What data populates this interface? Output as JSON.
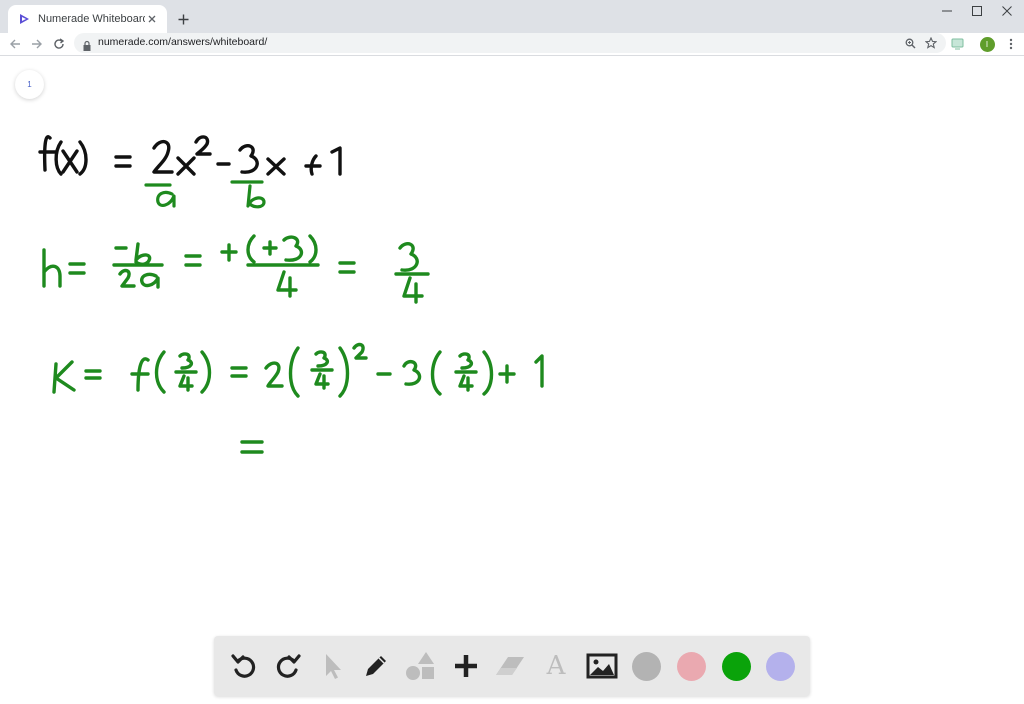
{
  "browser": {
    "tab_title": "Numerade Whiteboard",
    "url": "numerade.com/answers/whiteboard/",
    "profile_initial": "I"
  },
  "whiteboard": {
    "page_number": "1",
    "ink_color": "#1e8a1e",
    "handwriting": {
      "line1": "f(x) = 2x^2 - 3x + 1",
      "line1_labels": [
        "a",
        "b"
      ],
      "line2": "h = -b/2a = +(+3)/4 = 3/4",
      "line3": "K = f(3/4) = 2(3/4)^2 - 3(3/4) + 1",
      "line4": "="
    }
  },
  "toolbar": {
    "tools": [
      "undo-icon",
      "redo-icon",
      "pointer-icon",
      "pen-icon",
      "shapes-icon",
      "plus-icon",
      "eraser-icon",
      "text-icon",
      "image-icon"
    ],
    "text_tool_glyph": "A",
    "colors": [
      "#b3b3b3",
      "#eaa9b0",
      "#0aa30a",
      "#b4b1ec"
    ]
  }
}
